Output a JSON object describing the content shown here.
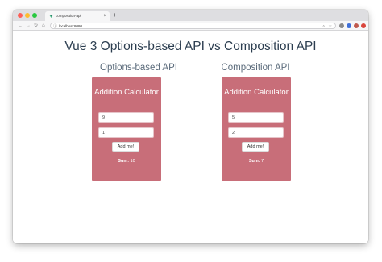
{
  "browser": {
    "tab_title": "composition-api",
    "tab_close": "×",
    "new_tab": "+",
    "url": "localhost:8080",
    "colors": {
      "close": "#fe5f57",
      "minimize": "#febc2e",
      "maximize": "#28c840",
      "favicon": "#41b883"
    }
  },
  "page": {
    "heading": "Vue 3 Options-based API vs Composition API",
    "columns": [
      {
        "heading": "Options-based API",
        "calculator": {
          "title": "Addition Calculator",
          "input_a": "9",
          "input_b": "1",
          "button_label": "Add me!",
          "sum_label": "Sum:",
          "sum_value": "10"
        }
      },
      {
        "heading": "Composition API",
        "calculator": {
          "title": "Addition Calculator",
          "input_a": "5",
          "input_b": "2",
          "button_label": "Add me!",
          "sum_label": "Sum:",
          "sum_value": "7"
        }
      }
    ],
    "colors": {
      "card": "#c86e79",
      "heading": "#2c3e50",
      "subheading": "#5b6b7b"
    }
  }
}
